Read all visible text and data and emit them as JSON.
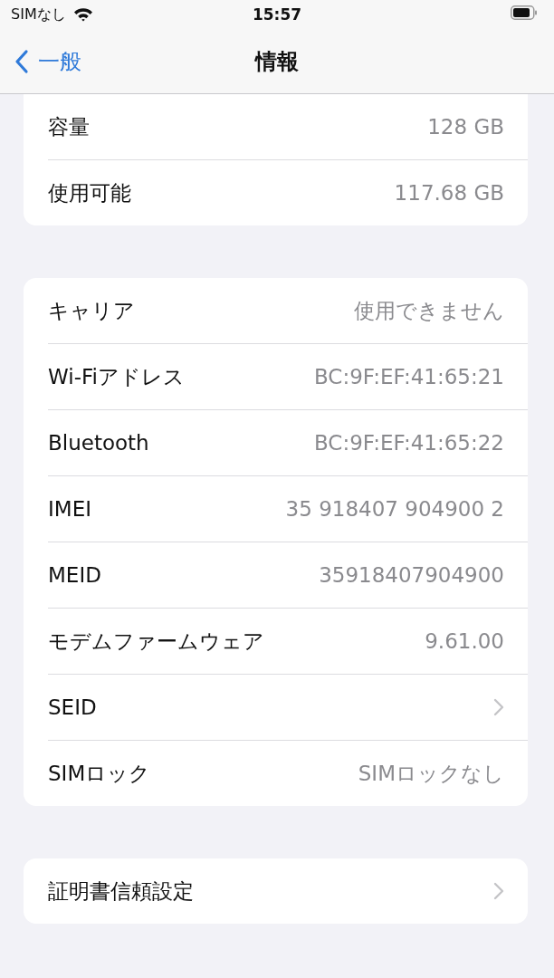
{
  "status_bar": {
    "carrier": "SIMなし",
    "time": "15:57"
  },
  "nav_bar": {
    "back": "一般",
    "title": "情報"
  },
  "groups": [
    {
      "rows": [
        {
          "kind": "value",
          "label": "容量",
          "value": "128 GB"
        },
        {
          "kind": "value",
          "label": "使用可能",
          "value": "117.68 GB"
        }
      ]
    },
    {
      "rows": [
        {
          "kind": "value",
          "label": "キャリア",
          "value": "使用できません"
        },
        {
          "kind": "value",
          "label": "Wi-Fiアドレス",
          "value": "BC:9F:EF:41:65:21"
        },
        {
          "kind": "value",
          "label": "Bluetooth",
          "value": "BC:9F:EF:41:65:22"
        },
        {
          "kind": "value",
          "label": "IMEI",
          "value": "35 918407 904900 2"
        },
        {
          "kind": "value",
          "label": "MEID",
          "value": "35918407904900"
        },
        {
          "kind": "value",
          "label": "モデムファームウェア",
          "value": "9.61.00"
        },
        {
          "kind": "link",
          "label": "SEID"
        },
        {
          "kind": "value",
          "label": "SIMロック",
          "value": "SIMロックなし"
        }
      ]
    },
    {
      "rows": [
        {
          "kind": "link",
          "label": "証明書信頼設定"
        }
      ]
    }
  ]
}
